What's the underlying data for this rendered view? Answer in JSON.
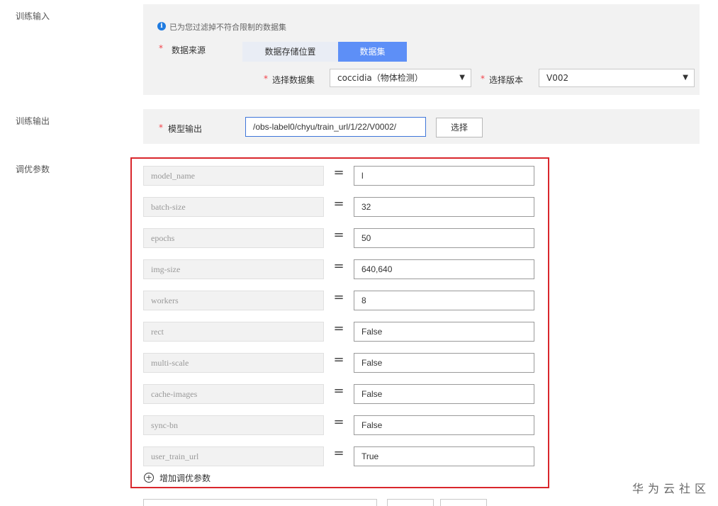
{
  "sections": {
    "train_input": "训练输入",
    "train_output": "训练输出",
    "tune_params": "调优参数"
  },
  "input": {
    "info_text": "已为您过滤掉不符合限制的数据集",
    "source_label": "数据来源",
    "tabs": [
      "数据存储位置",
      "数据集"
    ],
    "active_tab": "数据集",
    "dataset_label": "选择数据集",
    "dataset_value": "coccidia（物体检测）",
    "version_label": "选择版本",
    "version_value": "V002",
    "required_mark": "*"
  },
  "output": {
    "model_label": "模型输出",
    "model_path": "/obs-label0/chyu/train_url/1/22/V0002/",
    "select_button": "选择"
  },
  "params": {
    "equals": "=",
    "rows": [
      {
        "key": "model_name",
        "value": "l"
      },
      {
        "key": "batch-size",
        "value": "32"
      },
      {
        "key": "epochs",
        "value": "50"
      },
      {
        "key": "img-size",
        "value": "640,640"
      },
      {
        "key": "workers",
        "value": "8"
      },
      {
        "key": "rect",
        "value": "False"
      },
      {
        "key": "multi-scale",
        "value": "False"
      },
      {
        "key": "cache-images",
        "value": "False"
      },
      {
        "key": "sync-bn",
        "value": "False"
      },
      {
        "key": "user_train_url",
        "value": "True"
      }
    ],
    "add_label": "增加调优参数"
  },
  "watermark": "华为云社区",
  "colors": {
    "accent": "#5d8ff7",
    "highlight_border": "#d9262c",
    "required": "#f2434a",
    "info": "#1f7be0"
  }
}
